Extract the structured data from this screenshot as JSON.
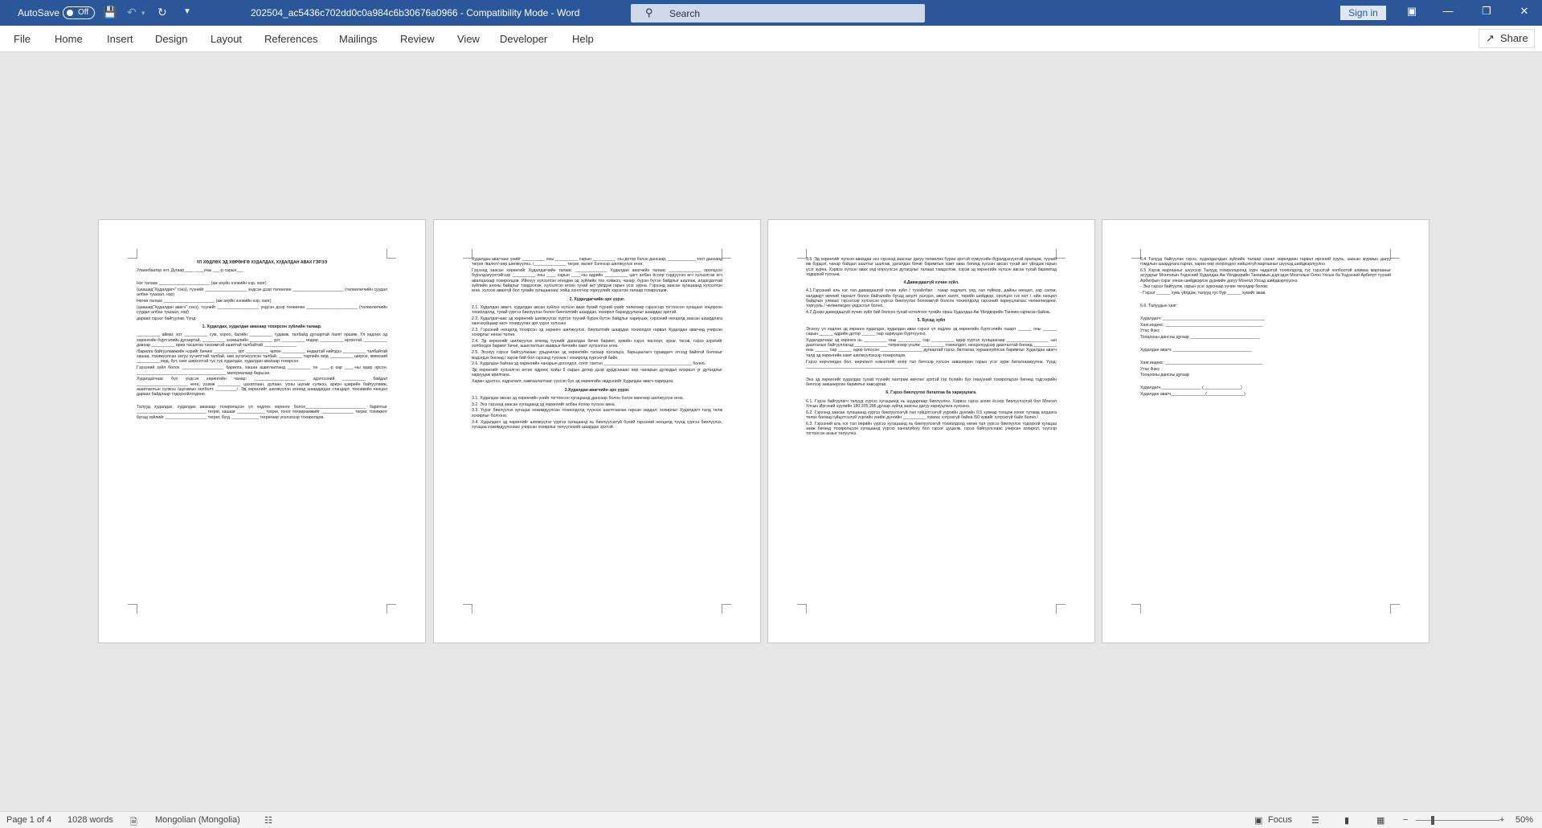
{
  "titlebar": {
    "autosave_label": "AutoSave",
    "autosave_state": "Off",
    "document_title": "202504_ac5436c702dd0c0a984c6b30676a0966  -  Compatibility Mode  -  Word",
    "search_placeholder": "Search",
    "signin_label": "Sign in"
  },
  "ribbon": {
    "tabs": [
      "File",
      "Home",
      "Insert",
      "Design",
      "Layout",
      "References",
      "Mailings",
      "Review",
      "View",
      "Developer",
      "Help"
    ],
    "share_label": "Share"
  },
  "pages": [
    {
      "blocks": [
        {
          "type": "h",
          "text": "ҮЛ ХӨДЛӨХ ЭД ХӨРӨНГӨ ХУДАЛДАХ, ХУДАЛДАН АВАХ ГЭРЭЭ"
        },
        {
          "type": "p",
          "text": "Улаанбаатар хот.                    Дугаар____                    ____оны ___-р сарын___"
        },
        {
          "type": "gap"
        },
        {
          "type": "p",
          "text": "Нэг талаас ______________________ (аж ахуйн нэгжийн нэр, хаяг)"
        },
        {
          "type": "p",
          "text": "(цаашид\"Худалдагч\" гэнэ), түүнийг __________________ үндсэн дээр төлөөлөн ______________________ (төлөөлөгчийн суудал албан тушаал, нэр)"
        },
        {
          "type": "p",
          "text": "Нөгөө талаас ______________________ (аж ахуйн нэгжийн нэр, хаяг)"
        },
        {
          "type": "p",
          "text": "(цаашид\"Худалдан авагч\" гэнэ), түүнийг __________________ үндсэн дээр төлөөлөн ______________________ (төлөөлөгчийн суудал албан тушаал, нэр)"
        },
        {
          "type": "p",
          "text": "дараах гэрээг байгуулав. Үүнд:"
        },
        {
          "type": "h",
          "text": "1.  Худалдах, худалдан авахаар тохирсон зүйлийн талаар."
        },
        {
          "type": "p",
          "text": "__________ аймаг, хот __________ сум, хороо, багийн __________ гудамж, талбайд дугаартай /хаяг/ оршиж, Үл хөдлөх эд хөрөнгийн бүртгэлийн дугаартай, __________ эзэмшлийн __________ үрт, __________ өндөр, __________ өргөнтэй, __________ давхар __________ өрөө тасалгаа тэнхимтэй ашигтай талбайтай ______________"
        },
        {
          "type": "p",
          "text": "/барилга байгууламжийн нэрийг бичих/ __________ үрт __________ өргөн __________ өндөртэй нийтдээ __________ талбайтай хашаа, тохижуулсан хатуу хучилттай талбай, зам зүлэгжүүлсэн талбай, __________ төрлийн мод __________ ширхэг, жимсний __________ мод, бут, сөөг ширхэгтэй тус тус худалдах, худалдан авахаар тохирсон."
        },
        {
          "type": "p",
          "text": "Гэрээний зүйл болох __________________ барилга, хашаа ашиглалтанд __________ он ____-р сар ____-ны өдөр орсон, ______________________ ________________ материалаар барьсан."
        },
        {
          "type": "p",
          "text": "Худалдагчаас бүх үндсэн хөрөнгийн чанар: ______________________ эдэлгээний __________ байдал ______________________ өнгө, үзэмж __________ цахилгаан, дулаан, усны шугам сүлжээ, ариун цэврийн байгууламж, ашиглалтын сүлжээ /шугамын холболт, _________/. Эд хөрөнгийг шилжүүлэн өгөхөд шаардагдах стандарт, техникийн нөхцөл дараах байдлаар тодорхойлогдоно."
        },
        {
          "type": "gap"
        },
        {
          "type": "p",
          "text": "Талууд худалдах, худалдан авахаар тохиролцсон үл хөдлөх хөрөнгө болох__________________________ барилгыг ______________________________ төгрөг, хашааг ____________ төгрөг, тоног төхөөрөмжийг ______________ төгрөг, тохижилт бусад зүйлийг __________________ төгрөг, бүгд ____________ төгрөгөөр үнэлэхээр тохиролцов."
        }
      ]
    },
    {
      "blocks": [
        {
          "type": "p",
          "text": "Худалдан авагчаас үнийг __________ оны __________ сарын __________ -ны дотор бэлэн дансаар, ____________ тоот дансанд төгрөг /валют/-өөр шилжүүлнэ. /______________ төгрөг, валют бэлнээр шилжүүлэх өгнө."
        },
        {
          "type": "p",
          "text": "Гэрээнд заасан хөрөнгийг Худалдагчийн талаас ______________ Худалдан авагчийн талаас ______________ оролцсон бүрэлдэхүүнтэйгээр __________ оны ____ сарын ____-ны өдрийн __________ цагт албан ёсоор тэрдүүлэн өгч хүлээлгэж өгч авалцахаар тохиролцов. Ийнхүү хүлээлгэн өгөхдөө эд зүйлийн тоо хэмжээ, чанар, бүрэн бүтэн байдлыг шалгаж, алдагдалтай зүйлийн анхны байдлыг тэмдэглэж, хүлээлгэн өгсөн тухай акт үйлдэж гарын үсэг зурна. Гэрээнд заасан хугацаанд хүлээлгэн өгөх, хүлээн авахгүй бол тухайн хугацаанаас хойш хоногоор торгуулийг хэрэглэх талаар тохиролцов."
        },
        {
          "type": "h",
          "text": "2. Худалдагчийн эрх үүрэг."
        },
        {
          "type": "p",
          "text": "2.1. Худалдан авагч, худалдан авсан зүйлээ хүлээн авах бүхий түүний үнийг төлөхөөр гэрээгээр тогтоосон хугацаат хоцорсон тохиолдолд, тухай үүргээ биелүүлэх болон биелэлтийг шаардах, хохирол барагдуулахыг шаардах эрхтэй."
        },
        {
          "type": "p",
          "text": "2.2. Худалдагчаас эд хөрөнгийг шилжүүлэх хүртэл түүний бүрэн бүтэн байдлыг хариуцах, гэрээний нөхцөлд заасан шаардлага хангахуйцаар засч тохируулах эрх үүрэг хүлээнэ."
        },
        {
          "type": "p",
          "text": "2.3. Гэрээний нөхцөлд тохирсон эд хөрөнгө шилжүүлэх, биелэлтийг шаардах тохиолдол гарвал Худалдан авагчид учирсан хохирлыг нөхөн төлнө."
        },
        {
          "type": "p",
          "text": "2.4. Эд хөрөнгийг шилжүүлэн өгөхөд түүнийг дагалдах бичиг баримт, хувийн хэрэг, паспорт, зураг, төсөв, гэрээ зэрэгийг холбогдох баримт бичиг, ашиглалтын зааврыг бичгийн хамт хүлээлгэн өгнө."
        },
        {
          "type": "p",
          "text": "2.5. Энэхүү гэрээг байгуулахаас урьдчилан эд хөрөнгийн талаар хэлэлцээ, барьцаалагч гуравдагч этгээд байхгүй болохыг мэдэгдэх бөгөөд / хэрэв бий бол гэрээнд тусгана / хохиролд хүргэхгүй байх."
        },
        {
          "type": "p",
          "text": "2.6. Худалдан байгаа эд хөрөнгийн чанарын доголдол, согог гэмтэл ______________________________________ болно."
        },
        {
          "type": "p",
          "text": "Эд хөрөнгийг хүлээлгэн өгсөн өдрөөс хойш 6 сарын дотор дээр дурдсанаас өөр чанарын дутагдал илэрвэл үг дутагдлыг хариуцаж арилгана."
        },
        {
          "type": "p",
          "text": "Харин эдэлгээ, хадгалалт, хамгаалалтаас үүссэн бүх эд хөрөнгийн эвдрэлийг Худалдан авагч хариуцна."
        },
        {
          "type": "h",
          "text": "3.Худалдан авагчийн эрх үүрэг."
        },
        {
          "type": "p",
          "text": "3.1. Худалдан авсан эд хөрөнгийн үнийг тогтоосон хугацаанд дансаар болон бэлэн мөнгөөр шилжүүлэн өгнө."
        },
        {
          "type": "p",
          "text": "3.2. Энэ гэрээнд заасан хугацаанд эд хөрөнгийг албан ёсоор хүлээн авна."
        },
        {
          "type": "p",
          "text": "3.3. Үүрэг биелүүлэх хугацаа хожимдуулсан тохиолдолд түүнээс шалтгаалан гарсан зардал, хохирлыг Худалдагч талд төлж хохирлыг болгоно."
        },
        {
          "type": "p",
          "text": "3.4. Худалдагч эд хөрөнгийг шилжүүлэх үүргээ хугацаанд нь биелүүлэхгүй бүхий гэрээний нөхцөлд түүнд үүргээ биелүүлэх, хугацаа хожимдуулснаас учирсан хохирлыг төлүүлэхийг шаардах эрхтэй."
        }
      ]
    },
    {
      "blocks": [
        {
          "type": "p",
          "text": "3.5. Эд хөрөнгийг хүлээн авахдаа энэ гэрээнд заасныг дагуу төлөөлөх бүрэн эрхтэй хүмүүсийн бүрэлдэхүүнтэй оролцож, түүний иж бүрдэл, чанар байдал заалтыг шалгаж, дагалдах бичиг баримтын хамт авах бөгөөд хүлээн авсан тухай акт үйлдэж гарын үсэг зурна. Хэрвээ хүлээн авах үед илрүүлсэн дутагдлыг талаар тэмдэглэж, хэрэв эд хөрөнгийн хүлээн авсан тухай баримтад тодорхой тусгана."
        },
        {
          "type": "h",
          "text": "4.Давагдашгүй хүчин зүйл."
        },
        {
          "type": "p",
          "text": "4.1.Гэрээний аль нэг тал давагдашгүй хүчин зүйл / тухайлбал : газар хөдлөлт, үер, гал түймэр, дайны нөхцөл, хар салхи, халдварт өвчний тархалт болон байгалийн бусад аюулт үзэгдэл, ажил хаялт, төрийн шийдвэр, оролцоо гэх мэт / -ийн нөхцөл байдлын улмаас гэрээгээр хүлээсэн үүргээ биелүүлэх боломжгүй болсон тохиолдолд гэрээний хариуцлагаас чөлөөлөгдөнө, торгууль / чөлөөлөгдөх үндэслэл болно."
        },
        {
          "type": "p",
          "text": "4.2 Дээрх давагдашгүй хүчин зүйл бий болсон тухай нотолгоог тухайн орны Худалдаа Аж Үйлдвэрийн Танхим гаргасан байна."
        },
        {
          "type": "h",
          "text": "5. Бусад зүйл"
        },
        {
          "type": "p",
          "text": "Энэхүү үл хөдлөх эд хөрөнгө худалдах, худалдан авах гэрээг үл хөдлөх эд хөрөнгийн бүртгэлийн газарт ______ оны ______ сарын ______ өдрийн дотор ______ нар хариуцан бүртгүүлнэ."
        },
        {
          "type": "p",
          "text": "Худалдагчаас эд хөрөнгө нь __________ оны __________ сар __________ өдөр хүртэл хугацаагаар __________________ -ын даатгалын байгууллагад ______________ төгрөгөөр үнэлж __________ тохиолдол, нөхцөлүүдээр даатгалтай бөгөөд __________ оны ______ сар ______ өдөр олгосон __________________ дугаартай гэрээ, батлагаа, хураангуйлсан баримтыг Худалдан авагч талд эд хөрөнгийн хамт шилжүүлэхээр тохиролцов."
        },
        {
          "type": "p",
          "text": "Гэрээ өөрчлөгдөх бол, өөрчлөлт нэмэлтийг хоёр тал бичгээр хүлээн зөвшөөрөн гарын үсэг зурж баталгаажуулна. Үүнд: ____________________________________________"
        },
        {
          "type": "gap"
        },
        {
          "type": "p",
          "text": "Энэ эд хөрөнгийг худалдах тухай түүнийг хантрам өмчлөх эрхтэй гэр бүлийн бүх гишүүний тохиролцсон бөгөөд тэдгээрийн бичгээр зөвшөөрсөн баримтыг хавсаргав."
        },
        {
          "type": "h",
          "text": "6.  Гэрээ биелүүлэх баталгаа ба хариуцлага."
        },
        {
          "type": "p",
          "text": "6.1. Гэрээ байгуулагч талууд үүргээ хугацаанд нь шударгаар биелүүлнэ. Хэрвээ гэрээ зохих ёсоор биелүүлээгүй бол Монгол Улсын Иргэний хуулийн 180,205,206 дугаар зүйлд заасны дагуу хариуцлага хүлээнэ."
        },
        {
          "type": "p",
          "text": "6.2. Гэрээнд заасан хугацаанд үүргээ биелүүлээгүй тал гүйцэтгээгүй үүргийн дүнгийн 0.5 хувиар тооцож хоног тутамд алданга төлөх бөгөөд гүйцэтгээгүй үүргийн үнийн дүнгийн __________ хувиас хэтрэхгүй байна /50 хувийг хэтрэхгүй байх болно./"
        },
        {
          "type": "p",
          "text": "6.3. Гэрээний аль нэг тал өөрийн үүргээ хугацаанд нь биелүүлэхгүй тохиолдолд нөгөө тал үүргээ биелүүлэх тодорхой хугацаа зааж бөгөөд тохиролцсон хугацаанд үүргээ хангагүйхүү бол гэрээг цуцалж, гэрээ байгуулснаас учирсан хохирол, түүгээр тогтоосон анзыг төлүүлнэ."
        }
      ]
    },
    {
      "blocks": [
        {
          "type": "p",
          "text": "6.4 Талууд байгуулах гэрээ, худалдагчдын зүйлийн талаар санал зөрөлдөөн гарвал иргэний хууль, заасан журмын дагуу гомдлын шаардлага гаргах, харин өөр хоорондоо нийцэхгүй маргааныг шүүхэд шийдвэрлүүлнэ."
        },
        {
          "type": "p",
          "text": "6.5 Хэрэв маргааныг шүүхээр Талууд тохиролцоонд хүрч чадахгүй тохиолдолд тус гэрээтэй холбоотой аливаа маргааныг асуудлыг Монголын Үндэсний Худалдаа Аж Үйлдвэрийн Танхимын дэргэдэх Монголын Олон Улсын ба Үндэсний Арбитрт түүний Арбитрын хэрэг хянан шийдвэрлэх дүрмийн дагуу Монгол Улсад шийдвэрлүүлнэ."
        },
        {
          "type": "p",
          "text": "- Энэ гэрээг байгуулж, гарын үсэг зурснаар хүчин төгөлдөр болов."
        },
        {
          "type": "p",
          "text": "- Гэрээг ______ хувь үйлдэж, талууд тус бүр ______ хувийг авав."
        },
        {
          "type": "gap"
        },
        {
          "type": "p",
          "text": "6.6.  Талуудын хаяг:"
        },
        {
          "type": "gap"
        },
        {
          "type": "p",
          "text": "Худалдагч: ____________________________________________"
        },
        {
          "type": "p",
          "text": "Хаяг,индекс: __________________________________________"
        },
        {
          "type": "p",
          "text": "Утас                    Факс"
        },
        {
          "type": "p",
          "text": "Тооцооны дансны дугаар ______________________________"
        },
        {
          "type": "gap"
        },
        {
          "type": "p",
          "text": "Худалдан авагч: __________________________________"
        },
        {
          "type": "gap"
        },
        {
          "type": "p",
          "text": "Хаяг,индекс: __________________________________________"
        },
        {
          "type": "p",
          "text": "Утас                    Факс"
        },
        {
          "type": "p",
          "text": "Тооцооны дансны дугаар"
        },
        {
          "type": "gap"
        },
        {
          "type": "p",
          "text": "              Худалдагч _________________  (________________)"
        },
        {
          "type": "p",
          "text": "              Худалдан авагч_______________(________________)"
        }
      ]
    }
  ],
  "statusbar": {
    "page_info": "Page 1 of 4",
    "word_count": "1028 words",
    "language": "Mongolian (Mongolia)",
    "focus_label": "Focus",
    "zoom": "50%"
  }
}
